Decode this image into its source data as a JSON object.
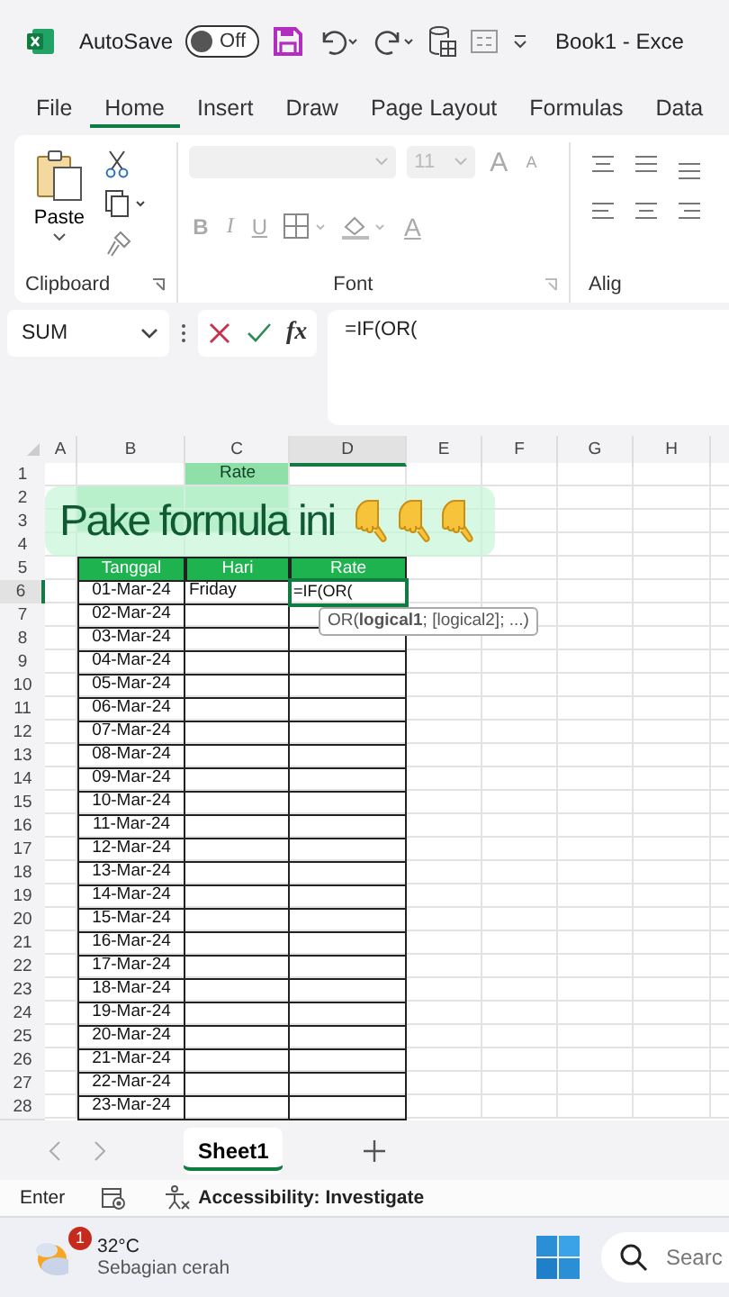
{
  "title_bar": {
    "autosave_label": "AutoSave",
    "autosave": {
      "on": false,
      "label": "Off"
    },
    "title": "Book1 - Exce"
  },
  "menu_tabs": [
    {
      "label": "File",
      "selected": false
    },
    {
      "label": "Home",
      "selected": true
    },
    {
      "label": "Insert",
      "selected": false
    },
    {
      "label": "Draw",
      "selected": false
    },
    {
      "label": "Page Layout",
      "selected": false
    },
    {
      "label": "Formulas",
      "selected": false
    },
    {
      "label": "Data",
      "selected": false
    }
  ],
  "ribbon": {
    "clipboard": {
      "paste_label": "Paste",
      "group_label": "Clipboard"
    },
    "font": {
      "size": "11",
      "grow": "A",
      "shrink": "A",
      "format_buttons": [
        "B",
        "I",
        "U"
      ],
      "color_button": "A",
      "group_label": "Font"
    },
    "alignment": {
      "group_label": "Alig"
    }
  },
  "formula_bar": {
    "name_box": "SUM",
    "fx_label": "fx",
    "formula": "=IF(OR("
  },
  "sheet": {
    "columns": [
      {
        "label": "A",
        "selected": false
      },
      {
        "label": "B",
        "selected": false
      },
      {
        "label": "C",
        "selected": false
      },
      {
        "label": "D",
        "selected": true
      },
      {
        "label": "E",
        "selected": false
      },
      {
        "label": "F",
        "selected": false
      },
      {
        "label": "G",
        "selected": false
      },
      {
        "label": "H",
        "selected": false
      }
    ],
    "rows": [
      {
        "number": "1",
        "kind": "summary",
        "c": "Rate",
        "selected": false
      },
      {
        "number": "2",
        "kind": "summary_wide",
        "selected": false
      },
      {
        "number": "3",
        "kind": "summary_wide",
        "selected": false
      },
      {
        "number": "4",
        "kind": "plain",
        "selected": false
      },
      {
        "number": "5",
        "kind": "header",
        "b": "Tanggal",
        "c": "Hari",
        "d": "Rate",
        "selected": false
      },
      {
        "number": "6",
        "kind": "data",
        "b": "01-Mar-24",
        "c": "Friday",
        "d": "=IF(OR(",
        "editing": true,
        "selected": true
      },
      {
        "number": "7",
        "kind": "data",
        "b": "02-Mar-24",
        "selected": false
      },
      {
        "number": "8",
        "kind": "data",
        "b": "03-Mar-24",
        "selected": false
      },
      {
        "number": "9",
        "kind": "data",
        "b": "04-Mar-24",
        "selected": false
      },
      {
        "number": "10",
        "kind": "data",
        "b": "05-Mar-24",
        "selected": false
      },
      {
        "number": "11",
        "kind": "data",
        "b": "06-Mar-24",
        "selected": false
      },
      {
        "number": "12",
        "kind": "data",
        "b": "07-Mar-24",
        "selected": false
      },
      {
        "number": "13",
        "kind": "data",
        "b": "08-Mar-24",
        "selected": false
      },
      {
        "number": "14",
        "kind": "data",
        "b": "09-Mar-24",
        "selected": false
      },
      {
        "number": "15",
        "kind": "data",
        "b": "10-Mar-24",
        "selected": false
      },
      {
        "number": "16",
        "kind": "data",
        "b": "11-Mar-24",
        "selected": false
      },
      {
        "number": "17",
        "kind": "data",
        "b": "12-Mar-24",
        "selected": false
      },
      {
        "number": "18",
        "kind": "data",
        "b": "13-Mar-24",
        "selected": false
      },
      {
        "number": "19",
        "kind": "data",
        "b": "14-Mar-24",
        "selected": false
      },
      {
        "number": "20",
        "kind": "data",
        "b": "15-Mar-24",
        "selected": false
      },
      {
        "number": "21",
        "kind": "data",
        "b": "16-Mar-24",
        "selected": false
      },
      {
        "number": "22",
        "kind": "data",
        "b": "17-Mar-24",
        "selected": false
      },
      {
        "number": "23",
        "kind": "data",
        "b": "18-Mar-24",
        "selected": false
      },
      {
        "number": "24",
        "kind": "data",
        "b": "19-Mar-24",
        "selected": false
      },
      {
        "number": "25",
        "kind": "data",
        "b": "20-Mar-24",
        "selected": false
      },
      {
        "number": "26",
        "kind": "data",
        "b": "21-Mar-24",
        "selected": false
      },
      {
        "number": "27",
        "kind": "data",
        "b": "22-Mar-24",
        "selected": false
      },
      {
        "number": "28",
        "kind": "data",
        "b": "23-Mar-24",
        "selected": false
      }
    ],
    "tooltip": "OR(**logical1**; [logical2]; ...)"
  },
  "caption": "Pake formula ini",
  "sheet_tabs": [
    {
      "label": "Sheet1",
      "selected": true
    }
  ],
  "status_bar": {
    "mode": "Enter",
    "accessibility": "Accessibility: Investigate"
  },
  "taskbar": {
    "weather": {
      "badge": "1",
      "temperature": "32°C",
      "description": "Sebagian cerah"
    },
    "search": "Searc"
  }
}
